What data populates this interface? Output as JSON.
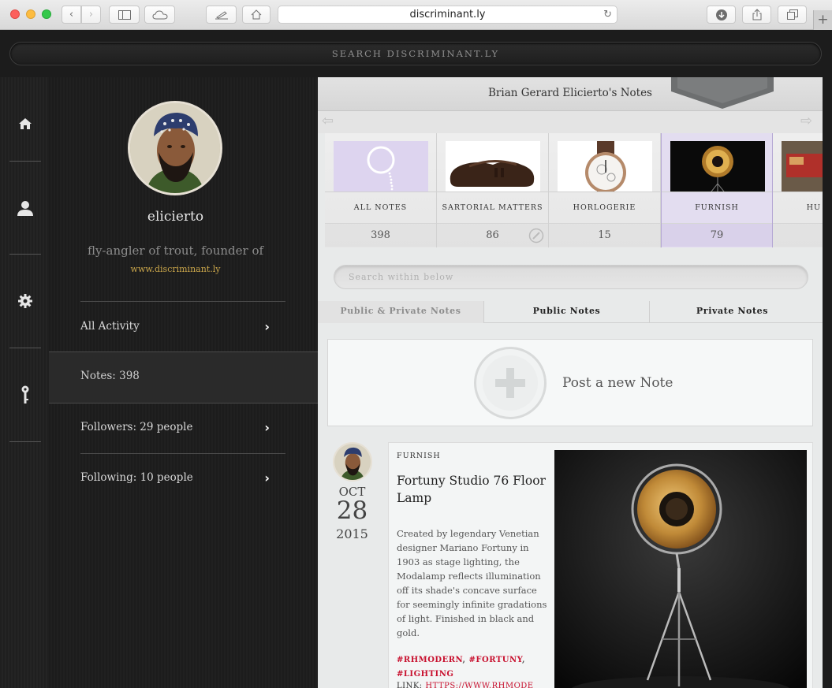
{
  "browser": {
    "url": "discriminant.ly",
    "new_tab": "+"
  },
  "site": {
    "search_label": "SEARCH DISCRIMINANT.LY"
  },
  "profile": {
    "username": "elicierto",
    "bio": "fly-angler of trout, founder of",
    "website": "www.discriminant.ly",
    "all_activity": "All Activity",
    "notes": "Notes: 398",
    "followers": "Followers: 29 people",
    "following": "Following: 10 people",
    "chevron": "›"
  },
  "main": {
    "header_title": "Brian Gerard Elicierto's Notes",
    "prev_arrow": "⇦",
    "next_arrow": "⇨",
    "categories": [
      {
        "label": "ALL NOTES",
        "count": "398"
      },
      {
        "label": "SARTORIAL MATTERS",
        "count": "86"
      },
      {
        "label": "HORLOGERIE",
        "count": "15"
      },
      {
        "label": "FURNISH",
        "count": "79"
      },
      {
        "label": "HU",
        "count": ""
      }
    ],
    "search_placeholder": "Search within below",
    "tabs": [
      "Public & Private Notes",
      "Public Notes",
      "Private Notes"
    ],
    "post_new": "Post a new Note"
  },
  "note": {
    "month": "OCT",
    "day": "28",
    "year": "2015",
    "category": "FURNISH",
    "title": "Fortuny Studio 76 Floor Lamp",
    "body": "Created by legendary Venetian designer Mariano Fortuny in 1903 as stage lighting, the Modalamp reflects illumination off its shade's concave surface for seemingly infinite gradations of light. Finished in black and gold.",
    "tags": [
      "#RHMODERN",
      "#FORTUNY",
      "#LIGHTING"
    ],
    "tag_sep": ",",
    "link_label": "LINK:",
    "link_url": "HTTPS://WWW.RHMODE"
  },
  "icons": {
    "rail": [
      "home-icon",
      "user-icon",
      "gear-icon",
      "key-icon"
    ]
  },
  "colors": {
    "accent_gold": "#c9a54a",
    "tag_red": "#c8102e",
    "active_category": "#e3ddf0"
  }
}
